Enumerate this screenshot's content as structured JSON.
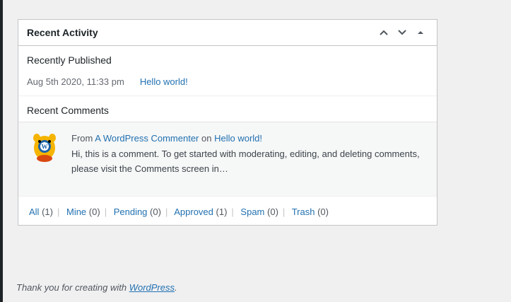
{
  "widget": {
    "title": "Recent Activity",
    "recently_published": {
      "heading": "Recently Published",
      "items": [
        {
          "date": "Aug 5th 2020, 11:33 pm",
          "title": "Hello world!"
        }
      ]
    },
    "recent_comments": {
      "heading": "Recent Comments",
      "comment": {
        "from_label": "From",
        "author": "A WordPress Commenter",
        "on_label": "on",
        "post": "Hello world!",
        "excerpt": "Hi, this is a comment. To get started with moderating, editing, and deleting comments, please visit the Comments screen in…"
      }
    },
    "filters": [
      {
        "label": "All",
        "count": "(1)"
      },
      {
        "label": "Mine",
        "count": "(0)"
      },
      {
        "label": "Pending",
        "count": "(0)"
      },
      {
        "label": "Approved",
        "count": "(1)"
      },
      {
        "label": "Spam",
        "count": "(0)"
      },
      {
        "label": "Trash",
        "count": "(0)"
      }
    ]
  },
  "footer": {
    "text": "Thank you for creating with",
    "link": "WordPress",
    "end": "."
  },
  "icons": {
    "move_up": "chevron-up-icon",
    "move_down": "chevron-down-icon",
    "toggle": "triangle-up-icon",
    "avatar": "wapuu-avatar-icon"
  },
  "colors": {
    "link": "#2271b1",
    "background": "#f0f0f1",
    "border": "#c3c4c7"
  }
}
